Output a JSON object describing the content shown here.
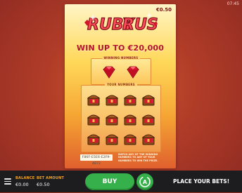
{
  "status": {
    "clock": "07:45"
  },
  "ticket": {
    "price": "€0.50",
    "logo_text": "RUBY RUSH",
    "headline": "WIN UP TO €20,000",
    "winning_numbers_title": "WINNING NUMBERS",
    "your_numbers_title": "YOUR NUMBERS",
    "serial": "F86F-E5E6-E2F9-4B72",
    "instructions": "MATCH ANY OF THE WINNING NUMBERS TO ANY OF YOUR NUMBERS TO WIN THE PRIZE."
  },
  "grid": {
    "rows": 3,
    "cols": 4
  },
  "footer": {
    "balance_label": "BALANCE",
    "balance_value": "€0.00",
    "bet_label": "BET AMOUNT",
    "bet_value": "€0.50",
    "buy_label": "BUY",
    "place_bets_label": "PLACE YOUR BETS!"
  },
  "icons": {
    "menu": "hamburger-menu-icon",
    "autoplay": "autoplay-icon",
    "winning_symbol": "ruby-gem-icon",
    "scratch_symbol": "treasure-chest-icon"
  },
  "colors": {
    "accent_green": "#36b04a",
    "label_orange": "#f2a52a",
    "headline_red": "#b3132a",
    "footer_bg": "#1d1d1f"
  }
}
